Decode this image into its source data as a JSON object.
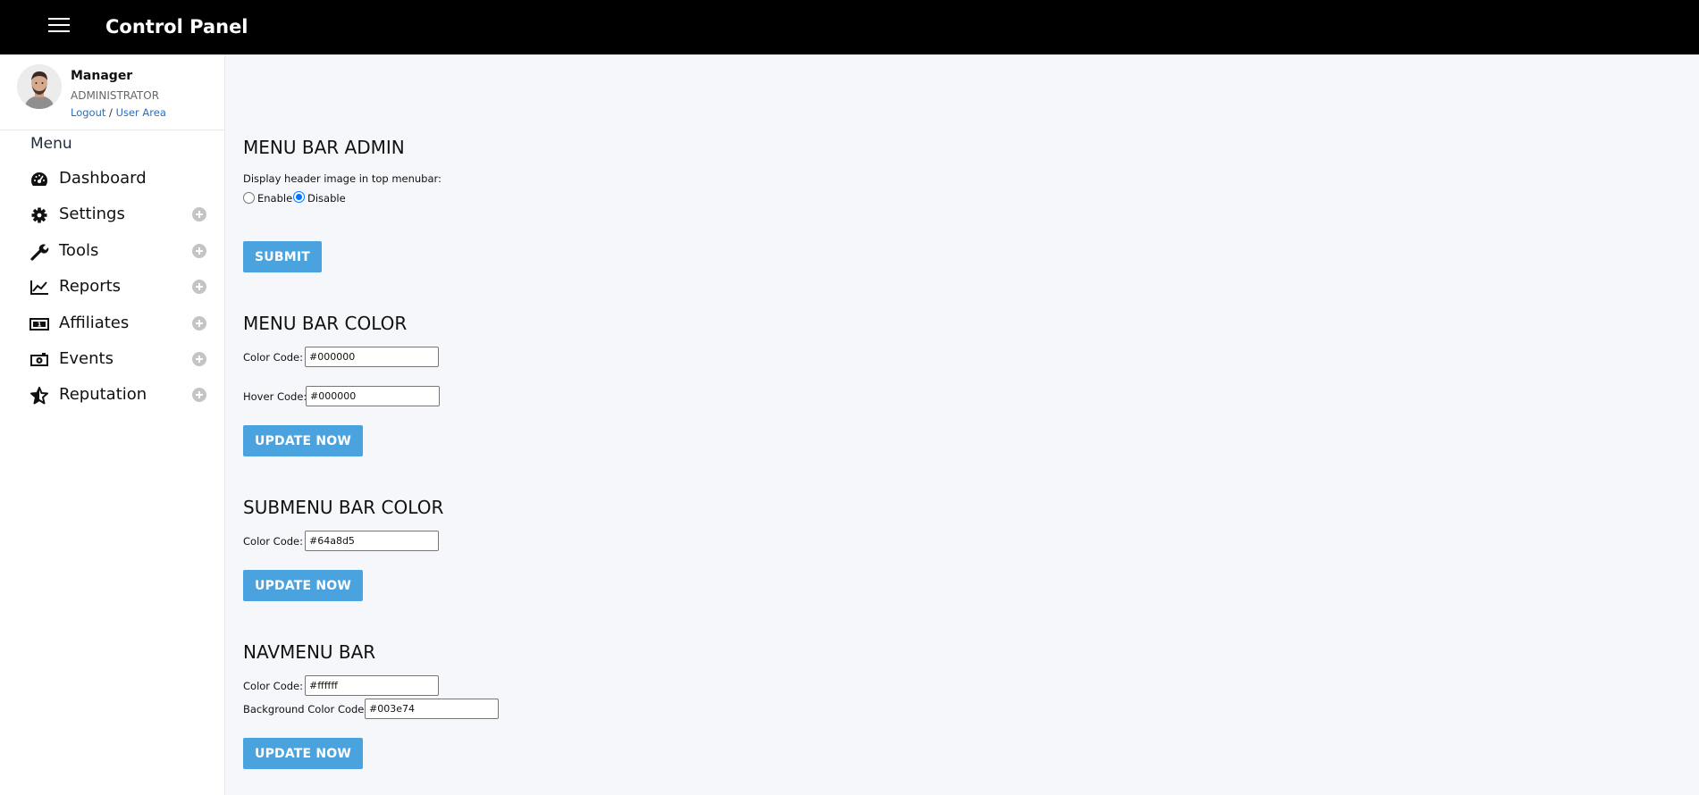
{
  "header": {
    "title": "Control Panel",
    "bg_color": "#000000"
  },
  "user": {
    "name": "Manager",
    "role": "ADMINISTRATOR",
    "logout_label": "Logout",
    "separator": "/",
    "user_area_label": "User Area"
  },
  "sidebar": {
    "menu_heading": "Menu",
    "items": [
      {
        "label": "Dashboard",
        "icon": "dashboard-icon",
        "expandable": false
      },
      {
        "label": "Settings",
        "icon": "gear-icon",
        "expandable": true
      },
      {
        "label": "Tools",
        "icon": "wrench-icon",
        "expandable": true
      },
      {
        "label": "Reports",
        "icon": "line-chart-icon",
        "expandable": true
      },
      {
        "label": "Affiliates",
        "icon": "money-bill-icon",
        "expandable": true
      },
      {
        "label": "Events",
        "icon": "camera-icon",
        "expandable": true
      },
      {
        "label": "Reputation",
        "icon": "star-icon",
        "expandable": true
      }
    ]
  },
  "sections": {
    "menu_bar_admin": {
      "title": "MENU BAR ADMIN",
      "description": "Display header image in top menubar:",
      "enable_label": "Enable",
      "disable_label": "Disable",
      "selected": "Disable",
      "submit_label": "SUBMIT"
    },
    "menu_bar_color": {
      "title": "MENU BAR COLOR",
      "color_label": "Color Code:",
      "color_value": "#000000",
      "hover_label": "Hover Code:",
      "hover_value": "#000000",
      "button_label": "UPDATE NOW"
    },
    "submenu_bar_color": {
      "title": "SUBMENU BAR COLOR",
      "color_label": "Color Code:",
      "color_value": "#64a8d5",
      "button_label": "UPDATE NOW"
    },
    "navmenu_bar": {
      "title": "NAVMENU BAR",
      "color_label": "Color Code:",
      "color_value": "#ffffff",
      "bg_label": "Background Color Code:",
      "bg_value": "#003e74",
      "button_label": "UPDATE NOW"
    }
  },
  "colors": {
    "accent_button": "#4aa3df",
    "link": "#2a6ebd",
    "page_bg": "#f5f7fa",
    "sidebar_bg": "#ffffff"
  }
}
